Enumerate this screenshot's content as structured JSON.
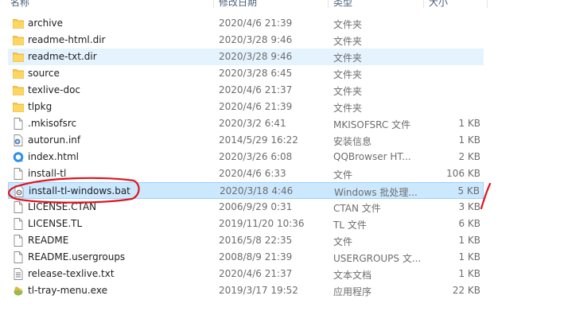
{
  "columns": {
    "name": "名称",
    "date": "修改日期",
    "type": "类型",
    "size": "大小"
  },
  "files": [
    {
      "name": "archive",
      "date": "2020/4/6 21:39",
      "type": "文件夹",
      "size": "",
      "icon": "folder-icon"
    },
    {
      "name": "readme-html.dir",
      "date": "2020/3/28 9:46",
      "type": "文件夹",
      "size": "",
      "icon": "folder-icon"
    },
    {
      "name": "readme-txt.dir",
      "date": "2020/3/28 9:46",
      "type": "文件夹",
      "size": "",
      "icon": "folder-icon"
    },
    {
      "name": "source",
      "date": "2020/3/28 6:45",
      "type": "文件夹",
      "size": "",
      "icon": "folder-icon"
    },
    {
      "name": "texlive-doc",
      "date": "2020/4/6 21:37",
      "type": "文件夹",
      "size": "",
      "icon": "folder-icon"
    },
    {
      "name": "tlpkg",
      "date": "2020/4/6 21:39",
      "type": "文件夹",
      "size": "",
      "icon": "folder-icon"
    },
    {
      "name": ".mkisofsrc",
      "date": "2020/3/2 6:41",
      "type": "MKISOFSRC 文件",
      "size": "1 KB",
      "icon": "file-icon"
    },
    {
      "name": "autorun.inf",
      "date": "2014/5/29 16:22",
      "type": "安装信息",
      "size": "1 KB",
      "icon": "settings-file-icon"
    },
    {
      "name": "index.html",
      "date": "2020/3/26 6:08",
      "type": "QQBrowser HT...",
      "size": "2 KB",
      "icon": "browser-icon"
    },
    {
      "name": "install-tl",
      "date": "2020/4/6 6:33",
      "type": "文件",
      "size": "106 KB",
      "icon": "file-icon"
    },
    {
      "name": "install-tl-windows.bat",
      "date": "2020/3/18 4:46",
      "type": "Windows 批处理...",
      "size": "5 KB",
      "icon": "batch-file-icon"
    },
    {
      "name": "LICENSE.CTAN",
      "date": "2006/9/29 0:31",
      "type": "CTAN 文件",
      "size": "3 KB",
      "icon": "file-icon"
    },
    {
      "name": "LICENSE.TL",
      "date": "2019/11/20 10:36",
      "type": "TL 文件",
      "size": "6 KB",
      "icon": "file-icon"
    },
    {
      "name": "README",
      "date": "2016/5/8 22:35",
      "type": "文件",
      "size": "1 KB",
      "icon": "file-icon"
    },
    {
      "name": "README.usergroups",
      "date": "2008/8/9 21:39",
      "type": "USERGROUPS 文...",
      "size": "1 KB",
      "icon": "file-icon"
    },
    {
      "name": "release-texlive.txt",
      "date": "2020/4/6 21:37",
      "type": "文本文档",
      "size": "1 KB",
      "icon": "text-file-icon"
    },
    {
      "name": "tl-tray-menu.exe",
      "date": "2019/3/17 19:52",
      "type": "应用程序",
      "size": "22 KB",
      "icon": "exe-icon"
    }
  ],
  "hovered_index": 2,
  "selected_index": 10,
  "annotation_color": "#e0141e"
}
